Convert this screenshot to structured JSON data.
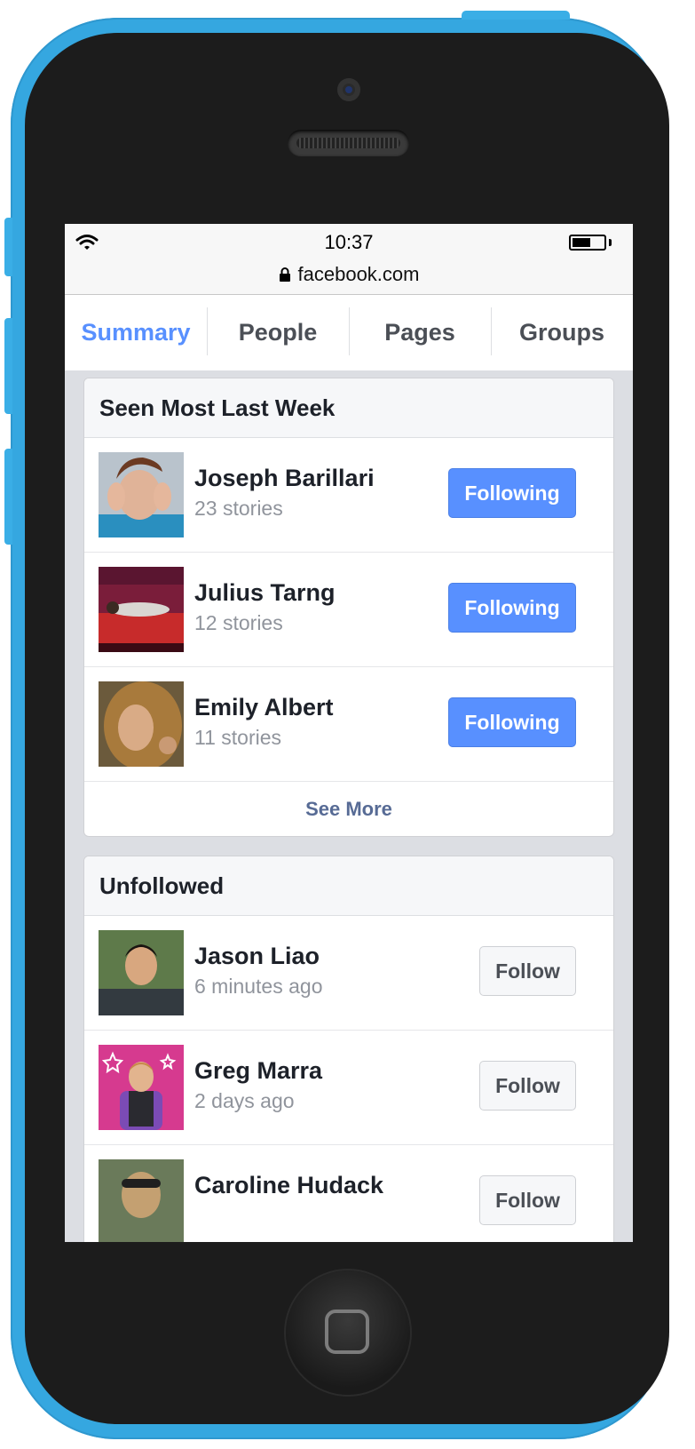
{
  "statusbar": {
    "time": "10:37",
    "url": "facebook.com"
  },
  "tabs": [
    {
      "label": "Summary",
      "active": true
    },
    {
      "label": "People"
    },
    {
      "label": "Pages"
    },
    {
      "label": "Groups"
    }
  ],
  "seen_most": {
    "title": "Seen Most Last Week",
    "people": [
      {
        "name": "Joseph Barillari",
        "sub": "23 stories",
        "button": "Following"
      },
      {
        "name": "Julius Tarng",
        "sub": "12 stories",
        "button": "Following"
      },
      {
        "name": "Emily Albert",
        "sub": "11 stories",
        "button": "Following"
      }
    ],
    "see_more": "See More"
  },
  "unfollowed": {
    "title": "Unfollowed",
    "people": [
      {
        "name": "Jason Liao",
        "sub": "6 minutes ago",
        "button": "Follow"
      },
      {
        "name": "Greg Marra",
        "sub": "2 days ago",
        "button": "Follow"
      },
      {
        "name": "Caroline Hudack",
        "sub": "",
        "button": "Follow"
      }
    ]
  },
  "colors": {
    "accent": "#5890ff",
    "shell": "#35a7e0",
    "link": "#576b95"
  }
}
